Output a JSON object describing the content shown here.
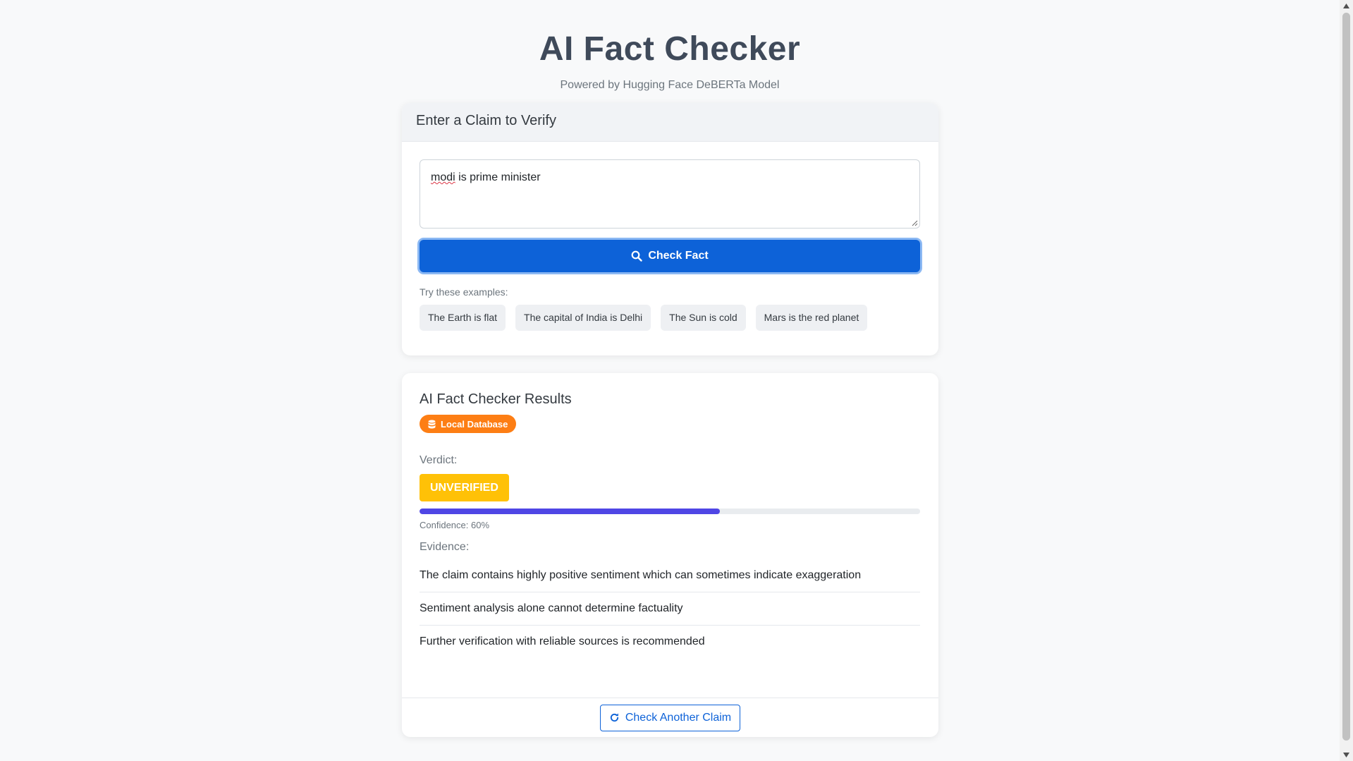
{
  "header": {
    "title": "AI Fact Checker",
    "subtitle": "Powered by Hugging Face DeBERTa Model"
  },
  "claim_card": {
    "heading": "Enter a Claim to Verify",
    "input_value_misspelled": "modi",
    "input_value_rest": " is prime minister",
    "check_button_label": "Check Fact",
    "check_button_icon": "search-icon",
    "examples_label": "Try these examples:",
    "examples": [
      "The Earth is flat",
      "The capital of India is Delhi",
      "The Sun is cold",
      "Mars is the red planet"
    ]
  },
  "results": {
    "title": "AI Fact Checker Results",
    "source_badge": "Local Database",
    "source_icon": "database-icon",
    "verdict_label": "Verdict:",
    "verdict": "UNVERIFIED",
    "confidence": 60,
    "confidence_text": "Confidence: 60%",
    "evidence_label": "Evidence:",
    "evidence": [
      "The claim contains highly positive sentiment which can sometimes indicate exaggeration",
      "Sentiment analysis alone cannot determine factuality",
      "Further verification with reliable sources is recommended"
    ],
    "another_button_label": "Check Another Claim",
    "another_button_icon": "redo-icon"
  },
  "colors": {
    "primary": "#0d62d8",
    "badge_orange": "#fd7e14",
    "verdict_yellow": "#ffc107",
    "progress": "#4f46e5"
  }
}
